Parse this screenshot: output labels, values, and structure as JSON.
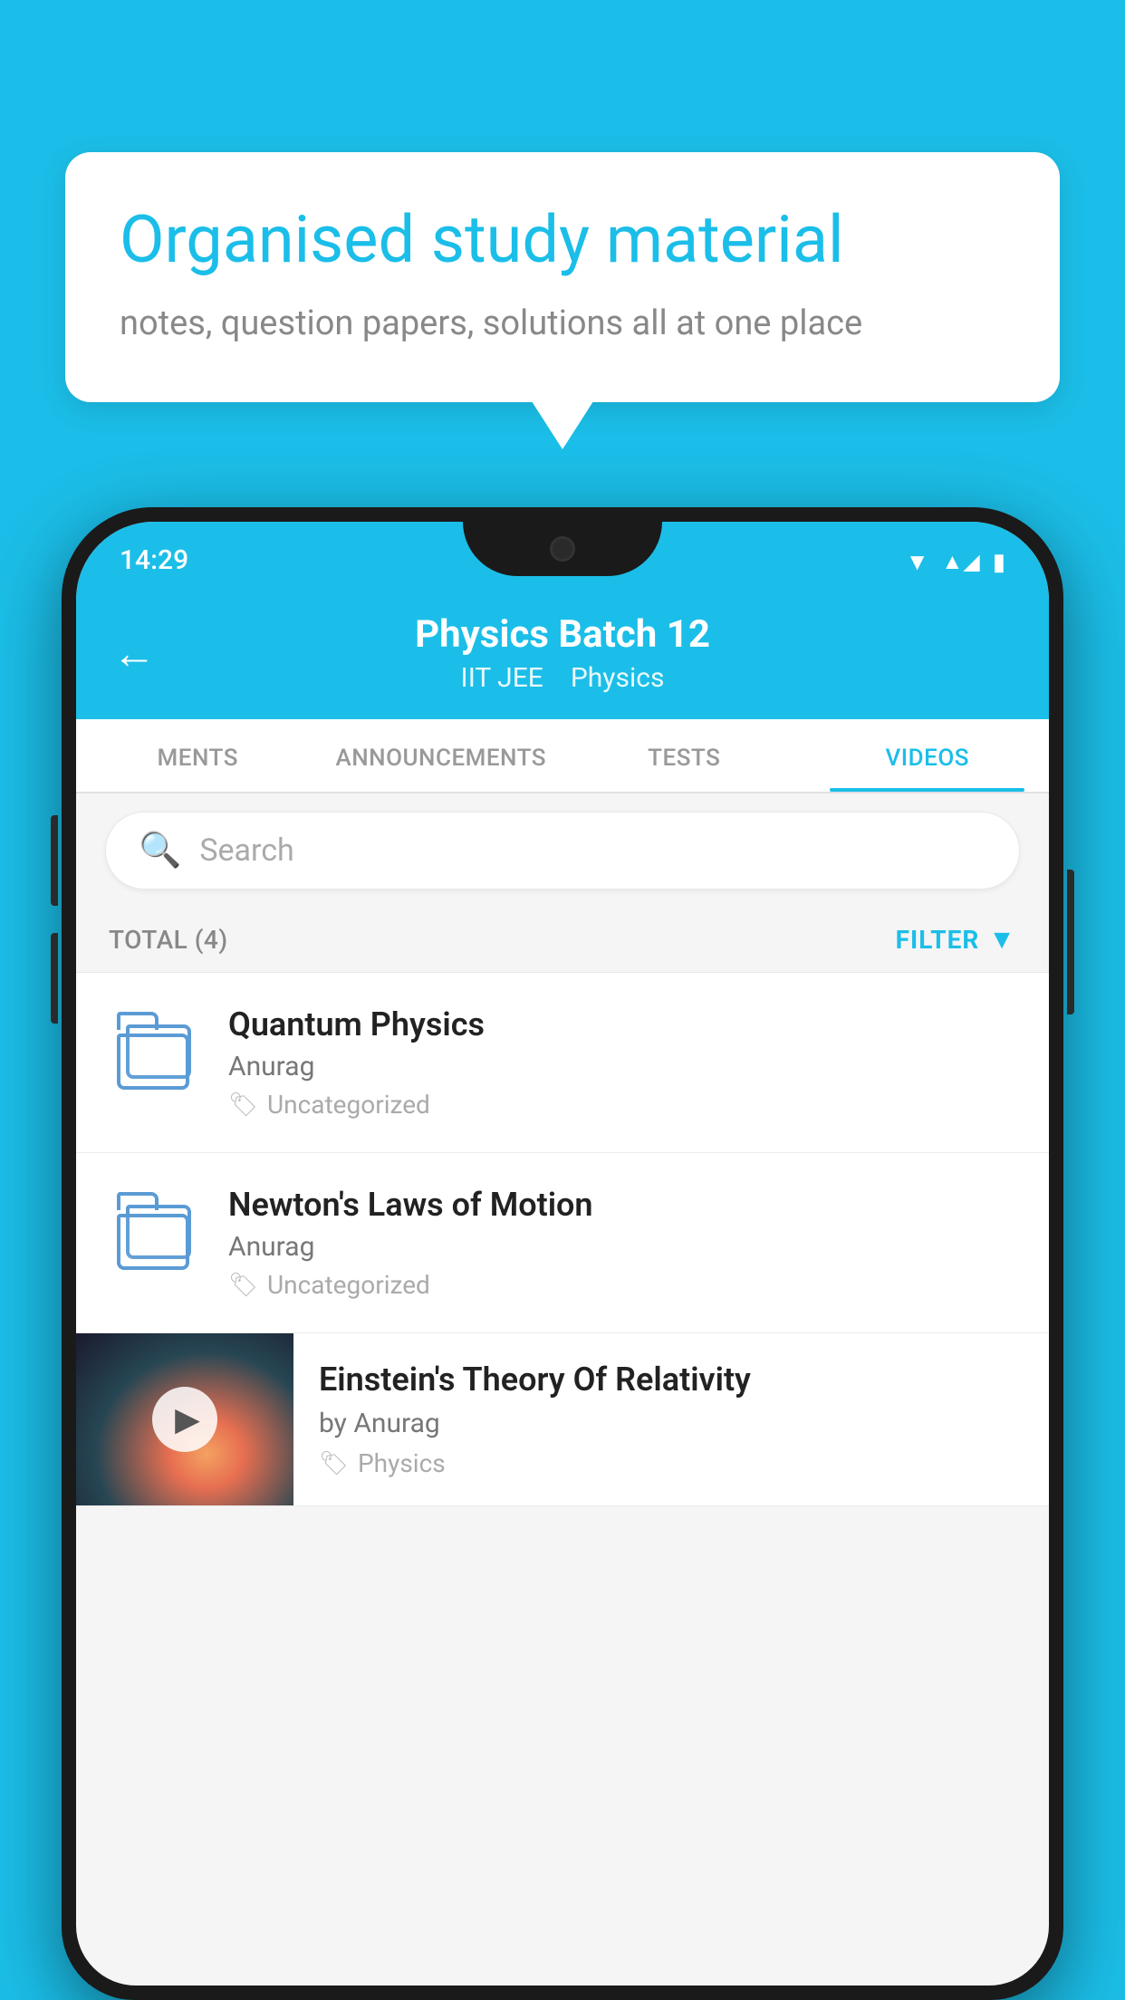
{
  "background": {
    "color": "#1bbee8"
  },
  "speech_bubble": {
    "title": "Organised study material",
    "subtitle": "notes, question papers, solutions all at one place"
  },
  "status_bar": {
    "time": "14:29"
  },
  "app_bar": {
    "title": "Physics Batch 12",
    "subtitle1": "IIT JEE",
    "subtitle2": "Physics",
    "back_label": "←"
  },
  "tabs": [
    {
      "label": "MENTS",
      "active": false
    },
    {
      "label": "ANNOUNCEMENTS",
      "active": false
    },
    {
      "label": "TESTS",
      "active": false
    },
    {
      "label": "VIDEOS",
      "active": true
    }
  ],
  "search": {
    "placeholder": "Search"
  },
  "filter_row": {
    "total_label": "TOTAL (4)",
    "filter_label": "FILTER"
  },
  "videos": [
    {
      "title": "Quantum Physics",
      "author": "Anurag",
      "tag": "Uncategorized",
      "has_thumb": false
    },
    {
      "title": "Newton's Laws of Motion",
      "author": "Anurag",
      "tag": "Uncategorized",
      "has_thumb": false
    },
    {
      "title": "Einstein's Theory Of Relativity",
      "author": "by Anurag",
      "tag": "Physics",
      "has_thumb": true
    }
  ]
}
